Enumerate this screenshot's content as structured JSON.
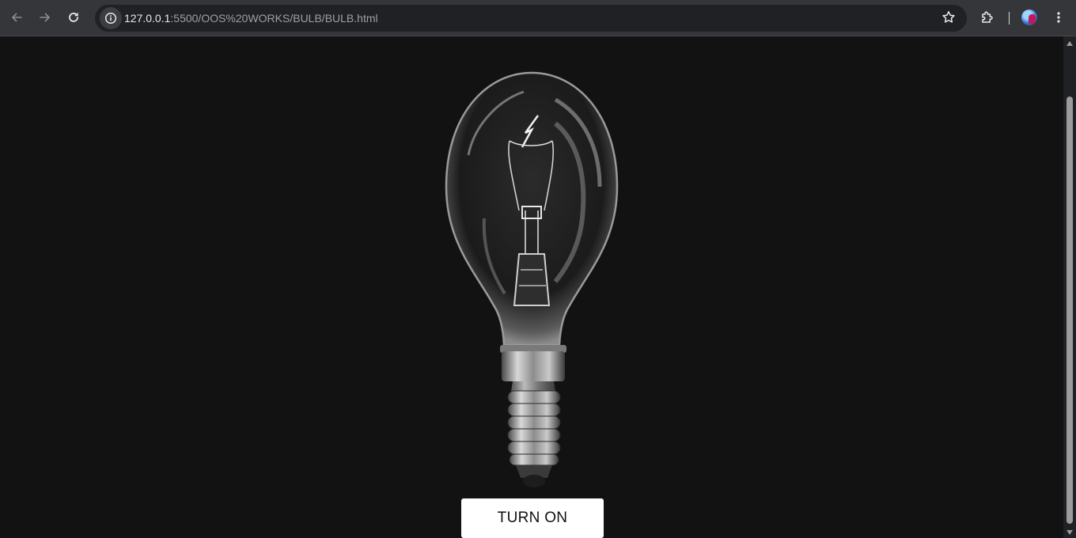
{
  "browser": {
    "url_host": "127.0.0.1",
    "url_path": ":5500/OOS%20WORKS/BULB/BULB.html",
    "icons": {
      "back": "arrow-left",
      "forward": "arrow-right",
      "reload": "reload",
      "site_info": "info-circle",
      "bookmark": "star",
      "extensions": "puzzle-piece",
      "profile": "avatar",
      "menu": "vertical-dots"
    }
  },
  "page": {
    "background_color": "#121212",
    "button_label": "TURN ON",
    "bulb_state": "off"
  }
}
